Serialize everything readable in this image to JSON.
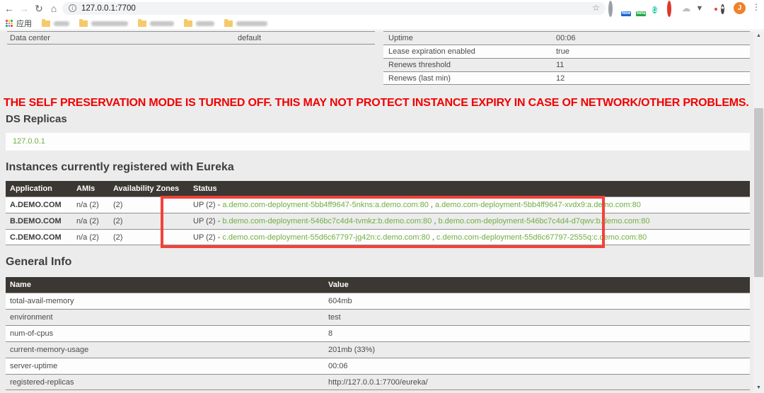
{
  "browser": {
    "url": "127.0.0.1:7700",
    "apps_label": "应用",
    "avatar_letter": "J",
    "grammarly_letter": "G",
    "badge_new": "New",
    "badge_beta": "beta"
  },
  "icons": {
    "back": "←",
    "forward": "→",
    "reload": "↻",
    "home": "⌂",
    "info": "i",
    "star": "☆",
    "cloud": "☁",
    "v": "▼",
    "pinwheel": "*",
    "menu": "⋮",
    "scroll_up": "▲",
    "scroll_down": "▼"
  },
  "colors": {
    "link_green": "#6faf44",
    "warning_red": "#f20000",
    "annotation_red": "#f2423b",
    "table_header_dark": "#3b3733"
  },
  "system_status": {
    "left_rows": [
      {
        "label": "Data center",
        "value": "default"
      }
    ],
    "right_rows": [
      {
        "label": "Uptime",
        "value": "00:06"
      },
      {
        "label": "Lease expiration enabled",
        "value": "true"
      },
      {
        "label": "Renews threshold",
        "value": "11"
      },
      {
        "label": "Renews (last min)",
        "value": "12"
      }
    ]
  },
  "warning_text": "THE SELF PRESERVATION MODE IS TURNED OFF. THIS MAY NOT PROTECT INSTANCE EXPIRY IN CASE OF NETWORK/OTHER PROBLEMS.",
  "ds_replicas": {
    "title": "DS Replicas",
    "replicas": [
      "127.0.0.1"
    ]
  },
  "instances": {
    "title": "Instances currently registered with Eureka",
    "headers": [
      "Application",
      "AMIs",
      "Availability Zones",
      "Status"
    ],
    "status_separator": " , ",
    "rows": [
      {
        "application": "A.DEMO.COM",
        "amis": "n/a (2)",
        "zones": "(2)",
        "status": "UP (2) - ",
        "links": [
          "a.demo.com-deployment-5bb4ff9647-5nkns:a.demo.com:80",
          "a.demo.com-deployment-5bb4ff9647-xvdx9:a.demo.com:80"
        ]
      },
      {
        "application": "B.DEMO.COM",
        "amis": "n/a (2)",
        "zones": "(2)",
        "status": "UP (2) - ",
        "links": [
          "b.demo.com-deployment-546bc7c4d4-tvmkz:b.demo.com:80",
          "b.demo.com-deployment-546bc7c4d4-d7qwv:b.demo.com:80"
        ]
      },
      {
        "application": "C.DEMO.COM",
        "amis": "n/a (2)",
        "zones": "(2)",
        "status": "UP (2) - ",
        "links": [
          "c.demo.com-deployment-55d6c67797-jg42n:c.demo.com:80",
          "c.demo.com-deployment-55d6c67797-2555q:c.demo.com:80"
        ]
      }
    ]
  },
  "general_info": {
    "title": "General Info",
    "headers": [
      "Name",
      "Value"
    ],
    "rows": [
      {
        "name": "total-avail-memory",
        "value": "604mb"
      },
      {
        "name": "environment",
        "value": "test"
      },
      {
        "name": "num-of-cpus",
        "value": "8"
      },
      {
        "name": "current-memory-usage",
        "value": "201mb (33%)"
      },
      {
        "name": "server-uptime",
        "value": "00:06"
      },
      {
        "name": "registered-replicas",
        "value": "http://127.0.0.1:7700/eureka/"
      }
    ]
  }
}
